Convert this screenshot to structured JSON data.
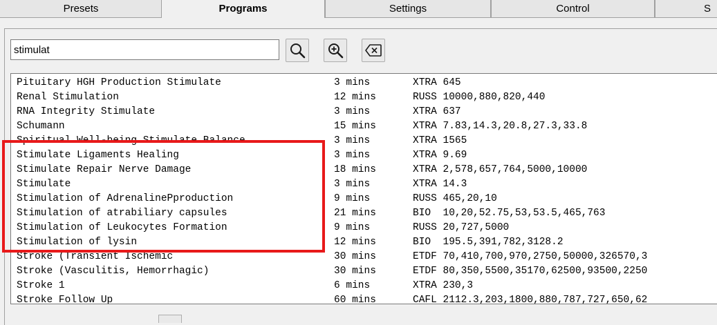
{
  "tabs": [
    {
      "label": "Presets",
      "active": false
    },
    {
      "label": "Programs",
      "active": true
    },
    {
      "label": "Settings",
      "active": false
    },
    {
      "label": "Control",
      "active": false
    },
    {
      "label": "S",
      "active": false
    }
  ],
  "search": {
    "value": "stimulat"
  },
  "icons": {
    "search": "magnifier-icon",
    "zoom_in": "magnifier-plus-icon",
    "clear": "backspace-clear-icon"
  },
  "programs": [
    {
      "name": "Pituitary HGH Production Stimulate",
      "duration": "3 mins",
      "codes": "XTRA 645"
    },
    {
      "name": "Renal Stimulation",
      "duration": "12 mins",
      "codes": "RUSS 10000,880,820,440"
    },
    {
      "name": "RNA Integrity Stimulate",
      "duration": "3 mins",
      "codes": "XTRA 637"
    },
    {
      "name": "Schumann",
      "duration": "15 mins",
      "codes": "XTRA 7.83,14.3,20.8,27.3,33.8"
    },
    {
      "name": "Spiritual Well-being Stimulate Balance",
      "duration": "3 mins",
      "codes": "XTRA 1565"
    },
    {
      "name": "Stimulate Ligaments Healing",
      "duration": "3 mins",
      "codes": "XTRA 9.69"
    },
    {
      "name": "Stimulate Repair Nerve Damage",
      "duration": "18 mins",
      "codes": "XTRA 2,578,657,764,5000,10000"
    },
    {
      "name": "Stimulate",
      "duration": "3 mins",
      "codes": "XTRA 14.3"
    },
    {
      "name": "Stimulation of AdrenalinePproduction",
      "duration": "9 mins",
      "codes": "RUSS 465,20,10"
    },
    {
      "name": "Stimulation of atrabiliary capsules",
      "duration": "21 mins",
      "codes": "BIO  10,20,52.75,53,53.5,465,763"
    },
    {
      "name": "Stimulation of Leukocytes Formation",
      "duration": "9 mins",
      "codes": "RUSS 20,727,5000"
    },
    {
      "name": "Stimulation of lysin",
      "duration": "12 mins",
      "codes": "BIO  195.5,391,782,3128.2"
    },
    {
      "name": "Stroke (Transient Ischemic",
      "duration": "30 mins",
      "codes": "ETDF 70,410,700,970,2750,50000,326570,3"
    },
    {
      "name": "Stroke (Vasculitis, Hemorrhagic)",
      "duration": "30 mins",
      "codes": "ETDF 80,350,5500,35170,62500,93500,2250"
    },
    {
      "name": "Stroke 1",
      "duration": "6 mins",
      "codes": "XTRA 230,3"
    },
    {
      "name": "Stroke Follow Up",
      "duration": "60 mins",
      "codes": "CAFL 2112.3,203,1800,880,787,727,650,62"
    }
  ],
  "colors": {
    "highlight": "#e8191a",
    "background": "#f0f0f0",
    "list_bg": "#ffffff"
  }
}
